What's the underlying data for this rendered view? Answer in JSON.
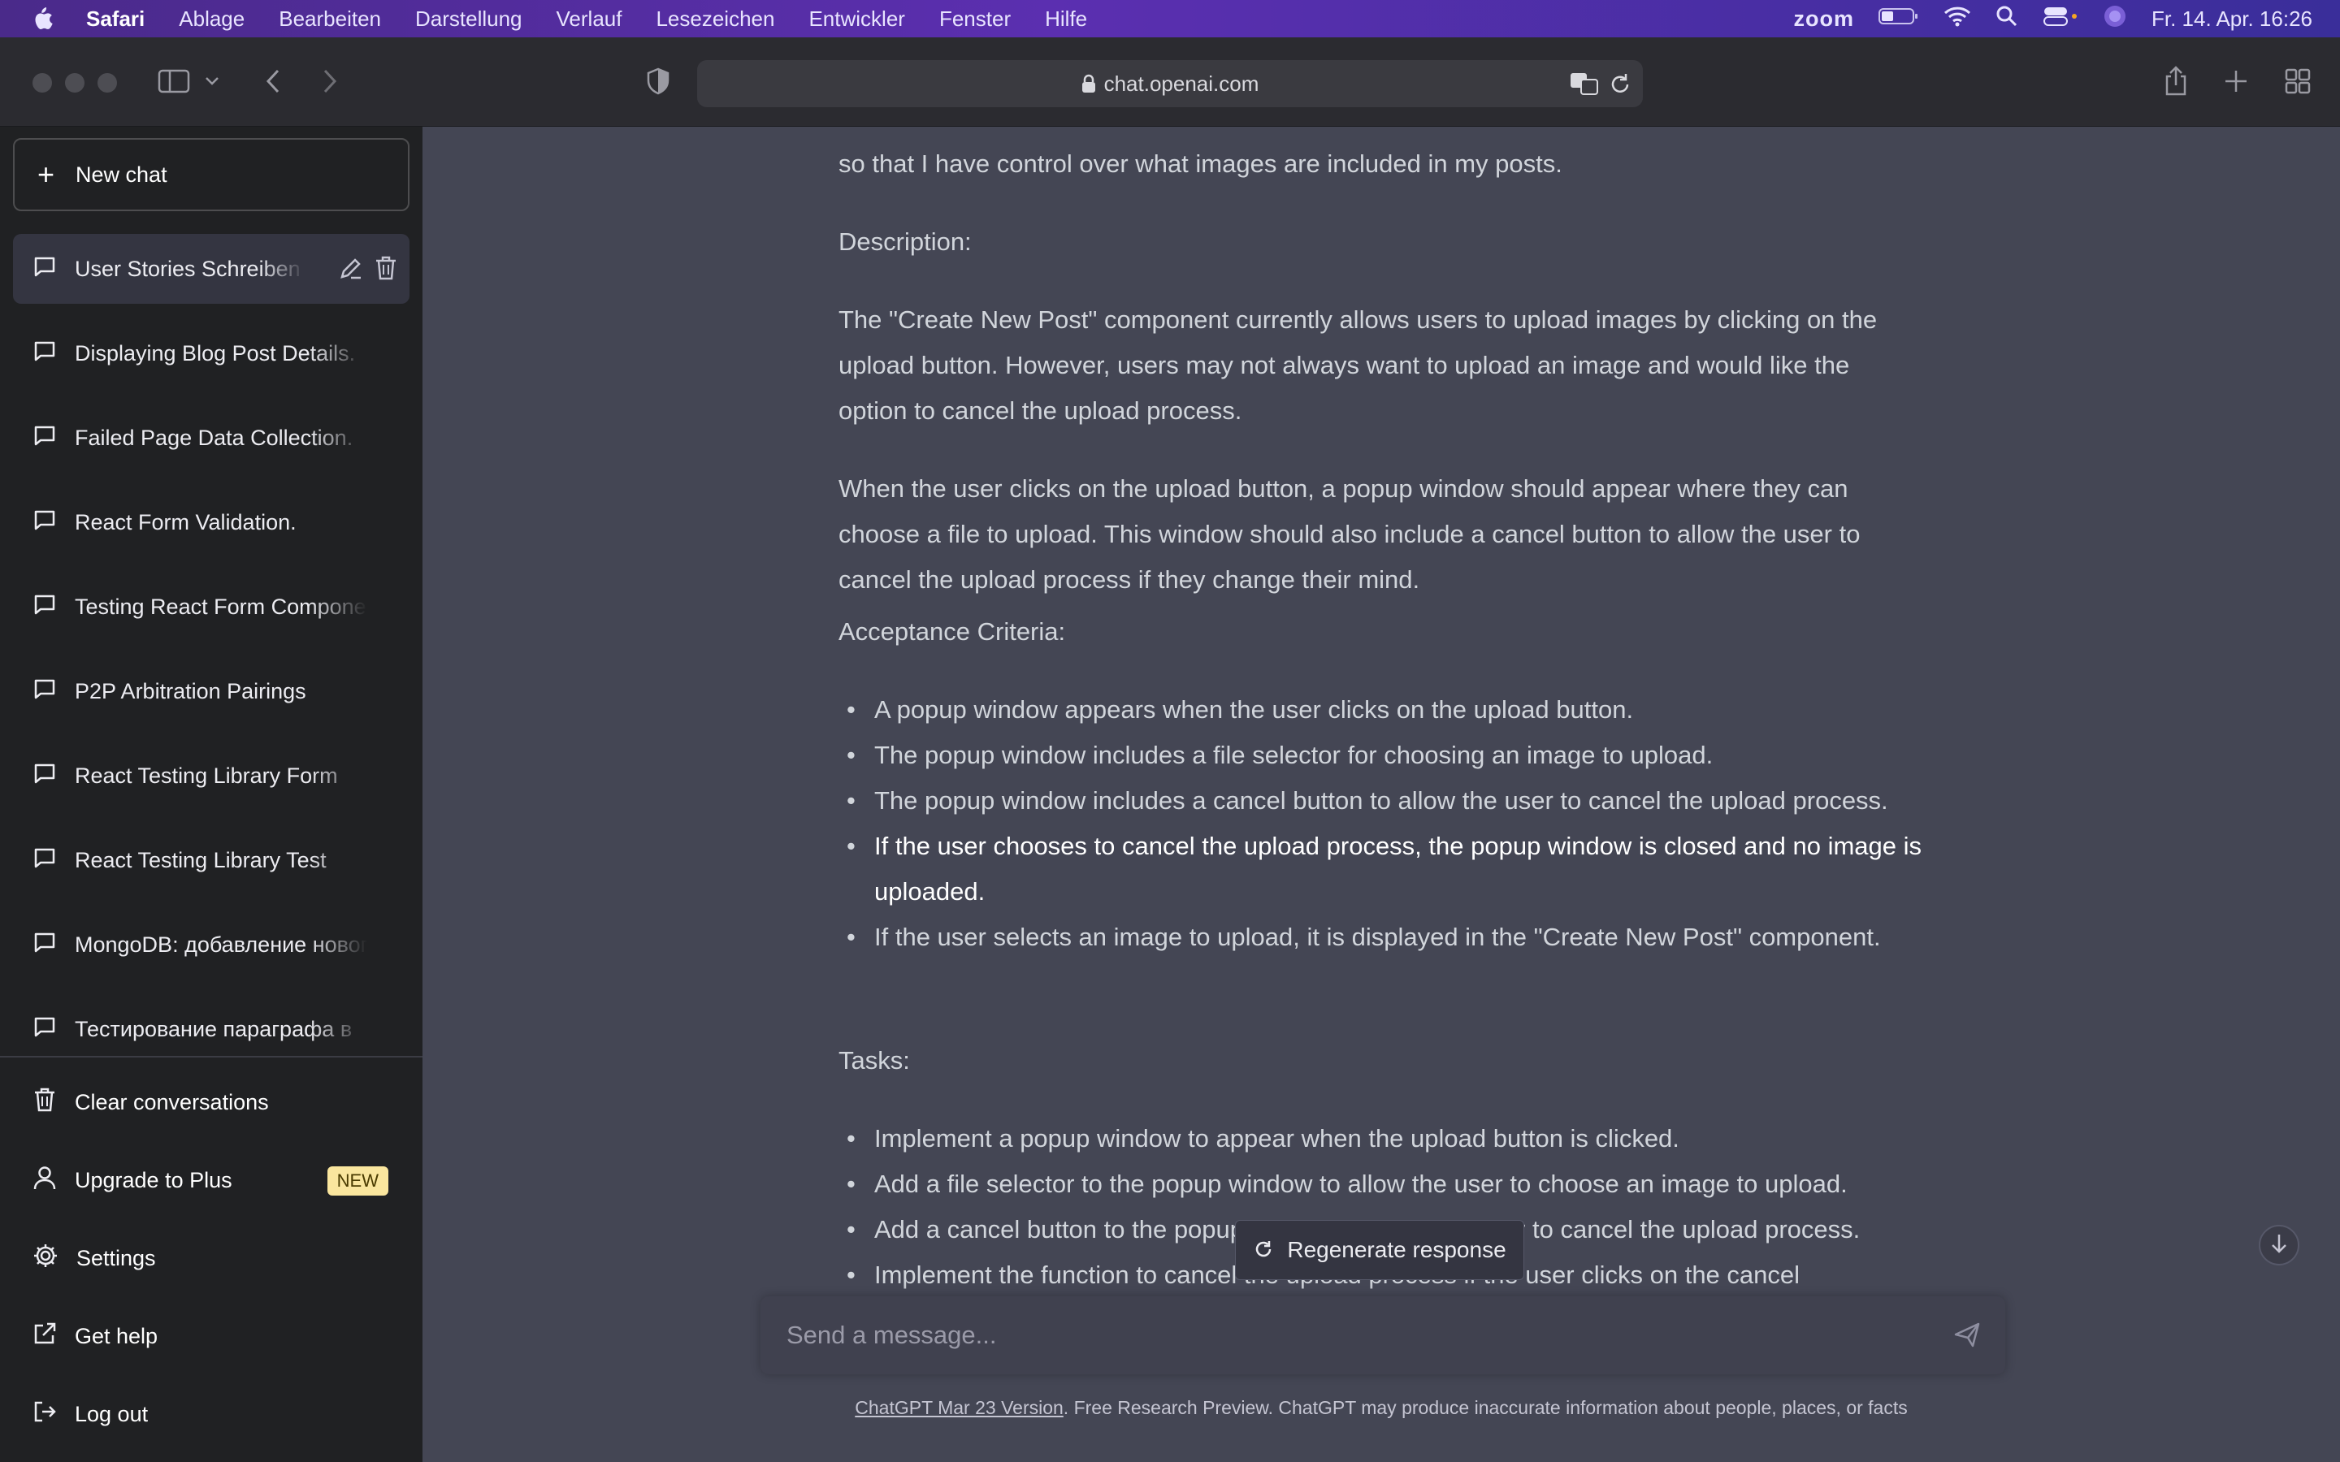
{
  "menubar": {
    "app": "Safari",
    "items": [
      "Ablage",
      "Bearbeiten",
      "Darstellung",
      "Verlauf",
      "Lesezeichen",
      "Entwickler",
      "Fenster",
      "Hilfe"
    ],
    "zoom_label": "zoom",
    "datetime": "Fr. 14. Apr.  16:26"
  },
  "browser": {
    "url": "chat.openai.com"
  },
  "sidebar": {
    "new_chat": "New chat",
    "conversations": [
      {
        "title": "User Stories Schreiben"
      },
      {
        "title": "Displaying Blog Post Details."
      },
      {
        "title": "Failed Page Data Collection."
      },
      {
        "title": "React Form Validation."
      },
      {
        "title": "Testing React Form Components"
      },
      {
        "title": "P2P Arbitration Pairings"
      },
      {
        "title": "React Testing Library Form"
      },
      {
        "title": "React Testing Library Test"
      },
      {
        "title": "MongoDB: добавление нового"
      },
      {
        "title": "Тестирование параграфа в"
      }
    ],
    "clear": "Clear conversations",
    "upgrade": "Upgrade to Plus",
    "upgrade_badge": "NEW",
    "settings": "Settings",
    "help": "Get help",
    "logout": "Log out"
  },
  "message": {
    "intro_tail": "so that I have control over what images are included in my posts.",
    "description_heading": "Description:",
    "description": "The \"Create New Post\" component currently allows users to upload images by clicking on the upload button. However, users may not always want to upload an image and would like the option to cancel the upload process.",
    "when": "When the user clicks on the upload button, a popup window should appear where they can choose a file to upload. This window should also include a cancel button to allow the user to cancel the upload process if they change their mind.",
    "acceptance_heading": "Acceptance Criteria:",
    "acceptance": [
      "A popup window appears when the user clicks on the upload button.",
      "The popup window includes a file selector for choosing an image to upload.",
      "The popup window includes a cancel button to allow the user to cancel the upload process.",
      "If the user chooses to cancel the upload process, the popup window is closed and no image is uploaded.",
      "If the user selects an image to upload, it is displayed in the \"Create New Post\" component."
    ],
    "tasks_heading": "Tasks:",
    "tasks": [
      "Implement a popup window to appear when the upload button is clicked.",
      "Add a file selector to the popup window to allow the user to choose an image to upload.",
      "Add a cancel button to the popup window to allow the user to cancel the upload process.",
      "Implement the function to cancel the upload process if the user clicks on the cancel"
    ]
  },
  "regenerate": "Regenerate response",
  "composer": {
    "placeholder": "Send a message..."
  },
  "footer": {
    "link": "ChatGPT Mar 23 Version",
    "text": ". Free Research Preview. ChatGPT may produce inaccurate information about people, places, or facts"
  }
}
